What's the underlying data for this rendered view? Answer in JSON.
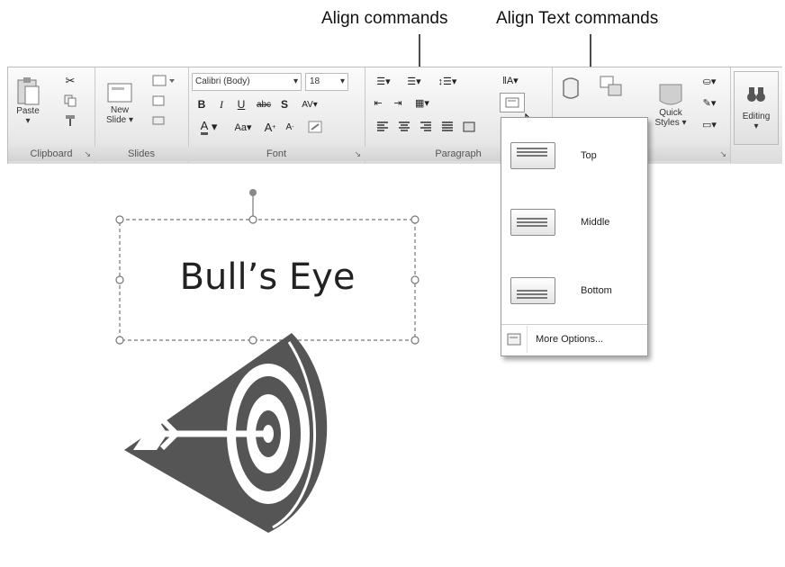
{
  "callouts": {
    "align_commands": "Align commands",
    "align_text_commands": "Align Text commands"
  },
  "ribbon": {
    "clipboard": {
      "paste": "Paste",
      "group": "Clipboard"
    },
    "slides": {
      "new_slide_1": "New",
      "new_slide_2": "Slide ▾",
      "group": "Slides"
    },
    "font": {
      "font_name": "Calibri (Body)",
      "font_size": "18",
      "group": "Font"
    },
    "paragraph": {
      "group": "Paragraph"
    },
    "drawing": {
      "quick_1": "Quick",
      "quick_2": "Styles ▾"
    },
    "editing": {
      "label": "Editing"
    }
  },
  "slide": {
    "title": "Bull’s Eye"
  },
  "dropdown": {
    "items": [
      {
        "label": "Top",
        "icon": "align-top-icon"
      },
      {
        "label": "Middle",
        "icon": "align-middle-icon"
      },
      {
        "label": "Bottom",
        "icon": "align-bottom-icon"
      }
    ],
    "more": "More Options..."
  }
}
